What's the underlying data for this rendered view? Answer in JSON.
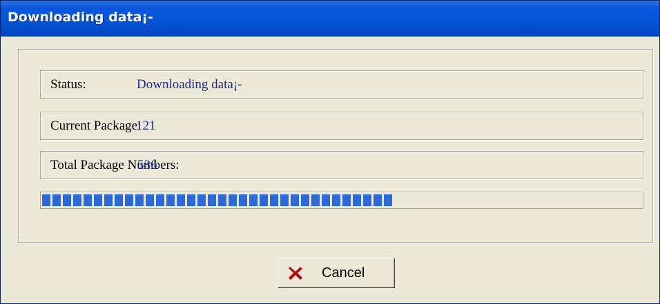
{
  "window": {
    "title": "Downloading data¡-"
  },
  "status": {
    "label": "Status:",
    "value": "Downloading data¡-"
  },
  "current_package": {
    "label": "Current Package:",
    "value": "121"
  },
  "total_packages": {
    "label": "Total Package Numbers:",
    "value": "536"
  },
  "progress": {
    "fraction": 0.6,
    "color": "#2d6ad9"
  },
  "buttons": {
    "cancel_label": "Cancel",
    "cancel_icon": "close-x-icon",
    "cancel_icon_color": "#b30f0f"
  }
}
